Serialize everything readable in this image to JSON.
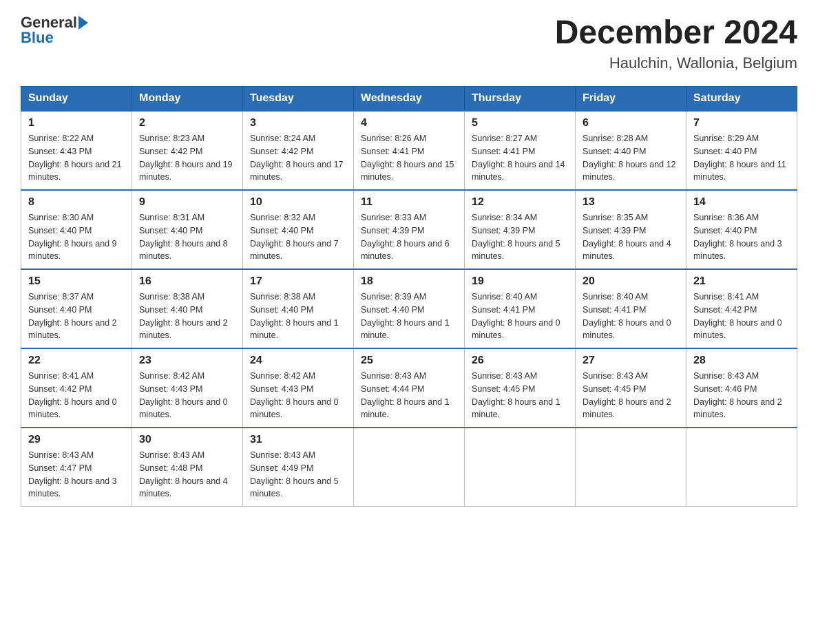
{
  "header": {
    "logo_text": "General",
    "logo_blue": "Blue",
    "month_title": "December 2024",
    "location": "Haulchin, Wallonia, Belgium"
  },
  "weekdays": [
    "Sunday",
    "Monday",
    "Tuesday",
    "Wednesday",
    "Thursday",
    "Friday",
    "Saturday"
  ],
  "weeks": [
    [
      {
        "day": "1",
        "sunrise": "8:22 AM",
        "sunset": "4:43 PM",
        "daylight": "8 hours and 21 minutes."
      },
      {
        "day": "2",
        "sunrise": "8:23 AM",
        "sunset": "4:42 PM",
        "daylight": "8 hours and 19 minutes."
      },
      {
        "day": "3",
        "sunrise": "8:24 AM",
        "sunset": "4:42 PM",
        "daylight": "8 hours and 17 minutes."
      },
      {
        "day": "4",
        "sunrise": "8:26 AM",
        "sunset": "4:41 PM",
        "daylight": "8 hours and 15 minutes."
      },
      {
        "day": "5",
        "sunrise": "8:27 AM",
        "sunset": "4:41 PM",
        "daylight": "8 hours and 14 minutes."
      },
      {
        "day": "6",
        "sunrise": "8:28 AM",
        "sunset": "4:40 PM",
        "daylight": "8 hours and 12 minutes."
      },
      {
        "day": "7",
        "sunrise": "8:29 AM",
        "sunset": "4:40 PM",
        "daylight": "8 hours and 11 minutes."
      }
    ],
    [
      {
        "day": "8",
        "sunrise": "8:30 AM",
        "sunset": "4:40 PM",
        "daylight": "8 hours and 9 minutes."
      },
      {
        "day": "9",
        "sunrise": "8:31 AM",
        "sunset": "4:40 PM",
        "daylight": "8 hours and 8 minutes."
      },
      {
        "day": "10",
        "sunrise": "8:32 AM",
        "sunset": "4:40 PM",
        "daylight": "8 hours and 7 minutes."
      },
      {
        "day": "11",
        "sunrise": "8:33 AM",
        "sunset": "4:39 PM",
        "daylight": "8 hours and 6 minutes."
      },
      {
        "day": "12",
        "sunrise": "8:34 AM",
        "sunset": "4:39 PM",
        "daylight": "8 hours and 5 minutes."
      },
      {
        "day": "13",
        "sunrise": "8:35 AM",
        "sunset": "4:39 PM",
        "daylight": "8 hours and 4 minutes."
      },
      {
        "day": "14",
        "sunrise": "8:36 AM",
        "sunset": "4:40 PM",
        "daylight": "8 hours and 3 minutes."
      }
    ],
    [
      {
        "day": "15",
        "sunrise": "8:37 AM",
        "sunset": "4:40 PM",
        "daylight": "8 hours and 2 minutes."
      },
      {
        "day": "16",
        "sunrise": "8:38 AM",
        "sunset": "4:40 PM",
        "daylight": "8 hours and 2 minutes."
      },
      {
        "day": "17",
        "sunrise": "8:38 AM",
        "sunset": "4:40 PM",
        "daylight": "8 hours and 1 minute."
      },
      {
        "day": "18",
        "sunrise": "8:39 AM",
        "sunset": "4:40 PM",
        "daylight": "8 hours and 1 minute."
      },
      {
        "day": "19",
        "sunrise": "8:40 AM",
        "sunset": "4:41 PM",
        "daylight": "8 hours and 0 minutes."
      },
      {
        "day": "20",
        "sunrise": "8:40 AM",
        "sunset": "4:41 PM",
        "daylight": "8 hours and 0 minutes."
      },
      {
        "day": "21",
        "sunrise": "8:41 AM",
        "sunset": "4:42 PM",
        "daylight": "8 hours and 0 minutes."
      }
    ],
    [
      {
        "day": "22",
        "sunrise": "8:41 AM",
        "sunset": "4:42 PM",
        "daylight": "8 hours and 0 minutes."
      },
      {
        "day": "23",
        "sunrise": "8:42 AM",
        "sunset": "4:43 PM",
        "daylight": "8 hours and 0 minutes."
      },
      {
        "day": "24",
        "sunrise": "8:42 AM",
        "sunset": "4:43 PM",
        "daylight": "8 hours and 0 minutes."
      },
      {
        "day": "25",
        "sunrise": "8:43 AM",
        "sunset": "4:44 PM",
        "daylight": "8 hours and 1 minute."
      },
      {
        "day": "26",
        "sunrise": "8:43 AM",
        "sunset": "4:45 PM",
        "daylight": "8 hours and 1 minute."
      },
      {
        "day": "27",
        "sunrise": "8:43 AM",
        "sunset": "4:45 PM",
        "daylight": "8 hours and 2 minutes."
      },
      {
        "day": "28",
        "sunrise": "8:43 AM",
        "sunset": "4:46 PM",
        "daylight": "8 hours and 2 minutes."
      }
    ],
    [
      {
        "day": "29",
        "sunrise": "8:43 AM",
        "sunset": "4:47 PM",
        "daylight": "8 hours and 3 minutes."
      },
      {
        "day": "30",
        "sunrise": "8:43 AM",
        "sunset": "4:48 PM",
        "daylight": "8 hours and 4 minutes."
      },
      {
        "day": "31",
        "sunrise": "8:43 AM",
        "sunset": "4:49 PM",
        "daylight": "8 hours and 5 minutes."
      },
      null,
      null,
      null,
      null
    ]
  ]
}
